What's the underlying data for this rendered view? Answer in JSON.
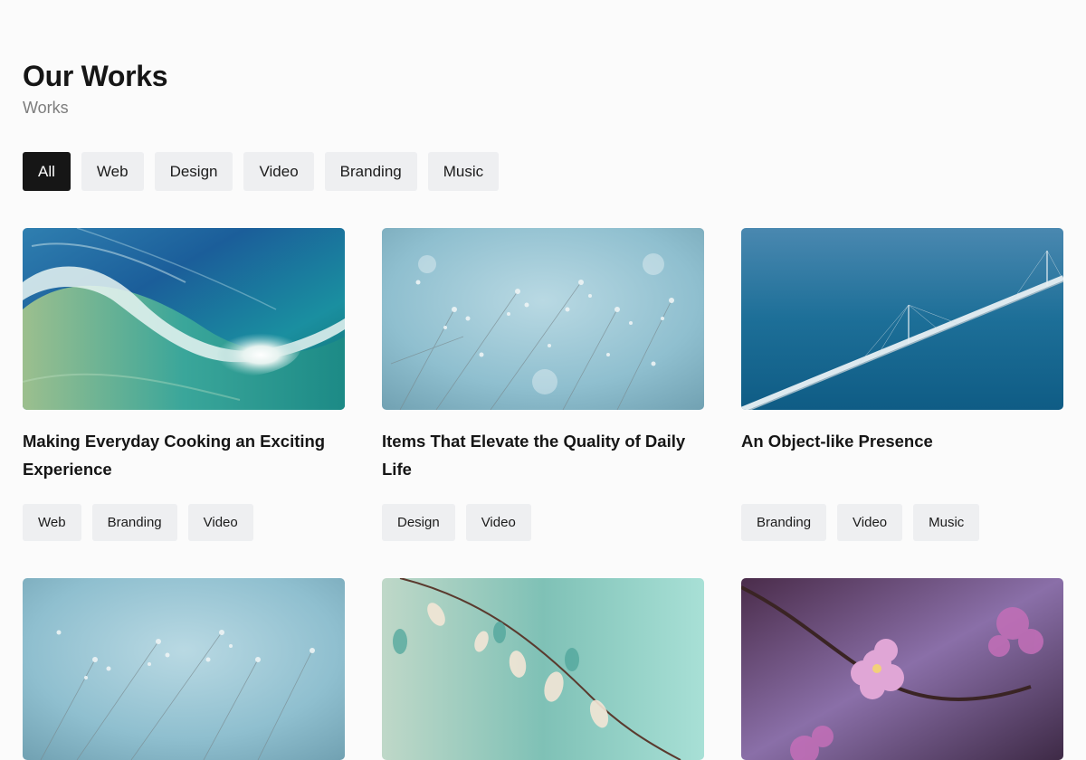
{
  "header": {
    "title": "Our Works",
    "subtitle": "Works"
  },
  "filters": [
    {
      "label": "All",
      "active": true
    },
    {
      "label": "Web",
      "active": false
    },
    {
      "label": "Design",
      "active": false
    },
    {
      "label": "Video",
      "active": false
    },
    {
      "label": "Branding",
      "active": false
    },
    {
      "label": "Music",
      "active": false
    }
  ],
  "works": [
    {
      "title": "Making Everyday Cooking an Exciting Experience",
      "image": "ocean-wave-photo",
      "tags": [
        "Web",
        "Branding",
        "Video"
      ]
    },
    {
      "title": "Items That Elevate the Quality of Daily Life",
      "image": "baby-breath-flowers-photo",
      "tags": [
        "Design",
        "Video"
      ]
    },
    {
      "title": "An Object-like Presence",
      "image": "aerial-bridge-photo",
      "tags": [
        "Branding",
        "Video",
        "Music"
      ]
    },
    {
      "title": "",
      "image": "baby-breath-flowers-photo",
      "tags": []
    },
    {
      "title": "",
      "image": "teal-leaves-branch-photo",
      "tags": []
    },
    {
      "title": "",
      "image": "pink-cherry-blossom-photo",
      "tags": []
    }
  ]
}
